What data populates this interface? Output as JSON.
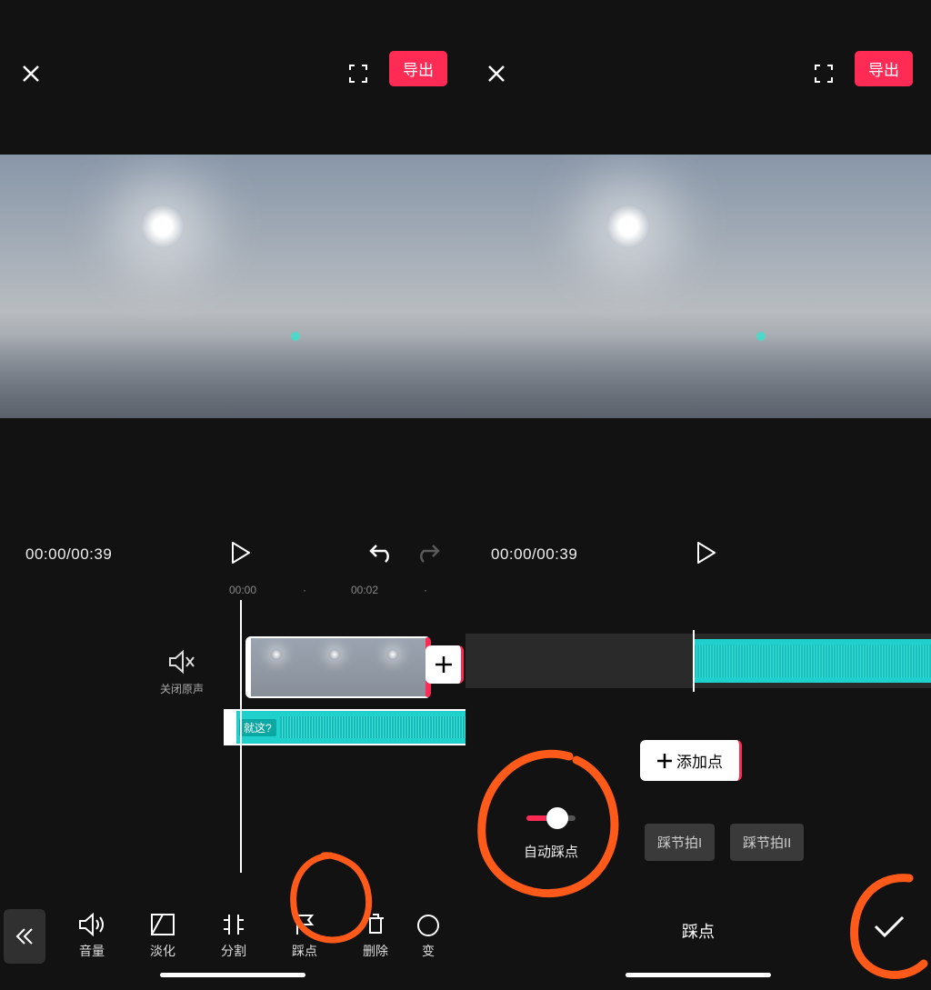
{
  "colors": {
    "accent": "#ff2b54",
    "annotation": "#ff5a1a",
    "audio": "#1fd0cc"
  },
  "left": {
    "export_label": "导出",
    "timecode": "00:00/00:39",
    "ruler": {
      "t0": "00:00",
      "t1": "00:02"
    },
    "mute_label": "关闭原声",
    "audio_clip_label": "就这?",
    "toolbar": {
      "volume": "音量",
      "fade": "淡化",
      "split": "分割",
      "beat": "踩点",
      "delete": "删除",
      "speed": "变"
    }
  },
  "right": {
    "export_label": "导出",
    "timecode": "00:00/00:39",
    "add_point_label": "添加点",
    "auto_beat_label": "自动踩点",
    "beat_option_1": "踩节拍I",
    "beat_option_2": "踩节拍II",
    "panel_title": "踩点"
  }
}
